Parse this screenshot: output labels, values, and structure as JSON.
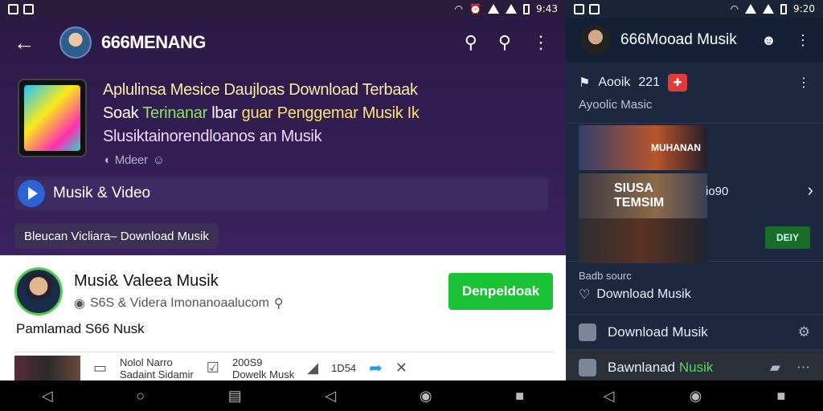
{
  "status_left": {
    "time": "9:43"
  },
  "status_right": {
    "time": "9:20"
  },
  "left": {
    "channel_title": "666MENANG",
    "hero": {
      "line1": "Aplulinsa Mesice  Daujloas Download Terbaak",
      "line2a": "Soak ",
      "line2b": "Terinanar ",
      "line2c": "lbar ",
      "line2d": "guar Penggemar Musik  Ik",
      "line3": "Slusiktainorendloanos an Musik",
      "line4": "Mdeer"
    },
    "category": "Musik & Video",
    "chip": "Bleucan Vicliara– Download Musik",
    "profile": {
      "name": "Musi& Valeea Musik",
      "sub": "S6S & Videra Imonanoaalucom",
      "button": "Denpeldoak"
    },
    "section_title": "Pamlamad S66 Nusk",
    "bottom_row": {
      "item1": "Nolol Narro",
      "item1b": "Sadaint Sidamir",
      "item2": "200S9",
      "item2b": "Dowelk Musk",
      "count": "1D54"
    }
  },
  "right": {
    "title": "666Mooad Musik",
    "card_title": "Aooik",
    "card_num": "221",
    "card_sub": "Ayoolic Masic",
    "thumb1": "MUHANAN",
    "thumb2": "SIUSA TEMSIM",
    "thumb_side": "io90",
    "green_btn": "DEIY",
    "label": "Badb sourc",
    "link": "Download Musik",
    "item1": "Download Musik",
    "item2a": "Bawnlanad ",
    "item2b": "Nusik"
  }
}
